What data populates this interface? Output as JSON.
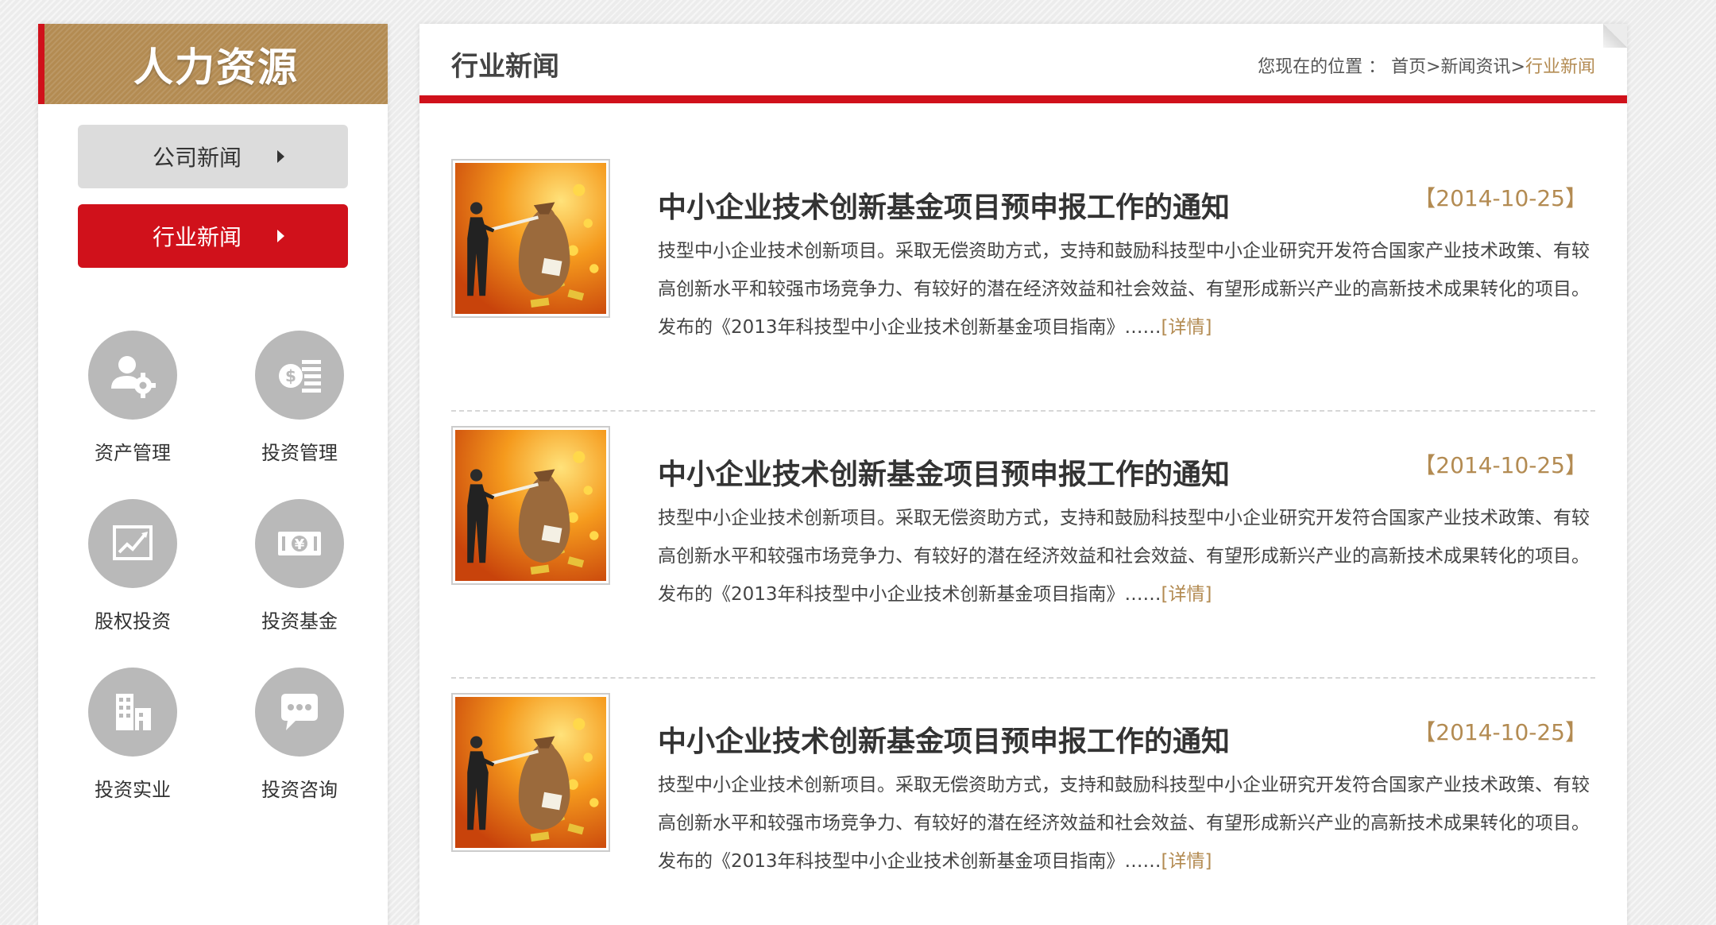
{
  "sidebar": {
    "title": "人力资源",
    "nav": [
      {
        "label": "公司新闻",
        "active": false
      },
      {
        "label": "行业新闻",
        "active": true
      }
    ],
    "icons": [
      {
        "label": "资产管理",
        "icon": "user-gear-icon"
      },
      {
        "label": "投资管理",
        "icon": "money-stack-icon"
      },
      {
        "label": "股权投资",
        "icon": "line-chart-icon"
      },
      {
        "label": "投资基金",
        "icon": "yen-banknote-icon"
      },
      {
        "label": "投资实业",
        "icon": "buildings-icon"
      },
      {
        "label": "投资咨询",
        "icon": "chat-bubble-icon"
      }
    ]
  },
  "main": {
    "title": "行业新闻",
    "breadcrumb": {
      "prefix": "您现在的位置 ：",
      "home": "首页",
      "separator": ">",
      "section": "新闻资讯",
      "current": "行业新闻"
    },
    "news": [
      {
        "title": "中小企业技术创新基金项目预申报工作的通知",
        "date": "【2014-10-25】",
        "summary": "技型中小企业技术创新项目。采取无偿资助方式，支持和鼓励科技型中小企业研究开发符合国家产业技术政策、有较高创新水平和较强市场竞争力、有较好的潜在经济效益和社会效益、有望形成新兴产业的高新技术成果转化的项目。发布的《2013年科技型中小企业技术创新基金项目指南》……",
        "more": "[详情]"
      },
      {
        "title": "中小企业技术创新基金项目预申报工作的通知",
        "date": "【2014-10-25】",
        "summary": "技型中小企业技术创新项目。采取无偿资助方式，支持和鼓励科技型中小企业研究开发符合国家产业技术政策、有较高创新水平和较强市场竞争力、有较好的潜在经济效益和社会效益、有望形成新兴产业的高新技术成果转化的项目。发布的《2013年科技型中小企业技术创新基金项目指南》……",
        "more": "[详情]"
      },
      {
        "title": "中小企业技术创新基金项目预申报工作的通知",
        "date": "【2014-10-25】",
        "summary": "技型中小企业技术创新项目。采取无偿资助方式，支持和鼓励科技型中小企业研究开发符合国家产业技术政策、有较高创新水平和较强市场竞争力、有较好的潜在经济效益和社会效益、有望形成新兴产业的高新技术成果转化的项目。发布的《2013年科技型中小企业技术创新基金项目指南》……",
        "more": "[详情]"
      }
    ]
  },
  "colors": {
    "accent_red": "#d0111b",
    "gold": "#b38b52",
    "icon_gray": "#b9b9b9"
  }
}
